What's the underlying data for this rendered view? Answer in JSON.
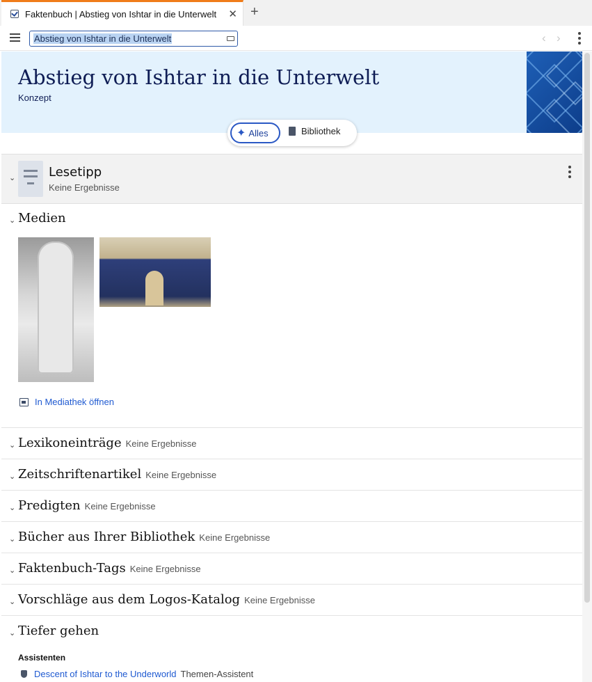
{
  "tab": {
    "title": "Faktenbuch | Abstieg von Ishtar in die Unterwelt",
    "close": "✕",
    "new": "+"
  },
  "address": {
    "value": "Abstieg von Ishtar in die Unterwelt"
  },
  "nav": {
    "back": "‹",
    "forward": "›"
  },
  "header": {
    "title": "Abstieg von Ishtar in die Unterwelt",
    "subtitle": "Konzept"
  },
  "filter": {
    "all_label": "Alles",
    "library_label": "Bibliothek"
  },
  "lesetipp": {
    "title": "Lesetipp",
    "status": "Keine Ergebnisse"
  },
  "media": {
    "title": "Medien",
    "open_link": "In Mediathek öffnen"
  },
  "sections": [
    {
      "title": "Lexikoneinträge",
      "status": "Keine Ergebnisse"
    },
    {
      "title": "Zeitschriftenartikel",
      "status": "Keine Ergebnisse"
    },
    {
      "title": "Predigten",
      "status": "Keine Ergebnisse"
    },
    {
      "title": "Bücher aus Ihrer Bibliothek",
      "status": "Keine Ergebnisse"
    },
    {
      "title": "Faktenbuch-Tags",
      "status": "Keine Ergebnisse"
    },
    {
      "title": "Vorschläge aus dem Logos-Katalog",
      "status": "Keine Ergebnisse"
    }
  ],
  "deeper": {
    "title": "Tiefer gehen",
    "assistants_heading": "Assistenten",
    "assistant_link": "Descent of Ishtar to the Underworld",
    "assistant_type": "Themen-Assistent"
  },
  "colors": {
    "accent": "#2a58c4",
    "link": "#1f5ad1",
    "banner_bg": "#e3f2fd",
    "tab_accent": "#f07c1a"
  }
}
